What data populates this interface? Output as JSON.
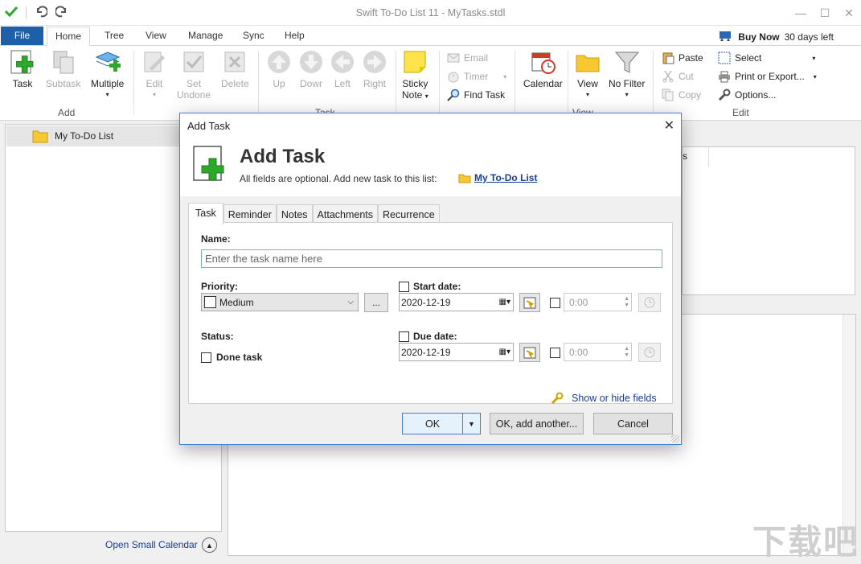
{
  "window": {
    "title": "Swift To-Do List 11 - MyTasks.stdl"
  },
  "ribbon_tabs": {
    "file": "File",
    "home": "Home",
    "tree": "Tree",
    "view": "View",
    "manage": "Manage",
    "sync": "Sync",
    "help": "Help"
  },
  "buy": {
    "label": "Buy Now",
    "days": "30 days left"
  },
  "ribbon": {
    "add": {
      "task": "Task",
      "subtask": "Subtask",
      "multiple": "Multiple",
      "group": "Add"
    },
    "task": {
      "edit": "Edit",
      "set_undone_1": "Set",
      "set_undone_2": "Undone",
      "delete": "Delete",
      "up": "Up",
      "down": "Dowr",
      "left": "Left",
      "right": "Right",
      "sticky_1": "Sticky",
      "sticky_2": "Note",
      "email": "Email",
      "timer": "Timer",
      "find": "Find Task",
      "group": "Task"
    },
    "view": {
      "calendar": "Calendar",
      "view": "View",
      "no_filter": "No Filter",
      "group": "View"
    },
    "edit": {
      "paste": "Paste",
      "cut": "Cut",
      "copy": "Copy",
      "select": "Select",
      "print": "Print or Export...",
      "options": "Options...",
      "group": "Edit"
    }
  },
  "left_panel": {
    "tree_item": "My To-Do List",
    "open_calendar": "Open Small Calendar"
  },
  "right_top": {
    "partial_header": "s"
  },
  "dialog": {
    "title": "Add Task",
    "heading": "Add Task",
    "subheading": "All fields are optional. Add new task to this list:",
    "list_link": "My To-Do List",
    "tabs": [
      "Task",
      "Reminder",
      "Notes",
      "Attachments",
      "Recurrence"
    ],
    "name_label": "Name:",
    "name_placeholder": "Enter the task name here",
    "priority_label": "Priority:",
    "priority_value": "Medium",
    "ellipsis": "...",
    "start_date_label": "Start date:",
    "start_date": "2020-12-19",
    "start_time": "0:00",
    "status_label": "Status:",
    "done_label": "Done task",
    "due_date_label": "Due date:",
    "due_date": "2020-12-19",
    "due_time": "0:00",
    "show_hide": "Show or hide fields",
    "ok": "OK",
    "ok_another": "OK, add another...",
    "cancel": "Cancel"
  },
  "watermark": "下载吧",
  "colors": {
    "file_tab": "#1d5fa8",
    "link": "#1a3d8f",
    "green_plus": "#2ea82a",
    "dialog_border": "#3d7fd1"
  }
}
